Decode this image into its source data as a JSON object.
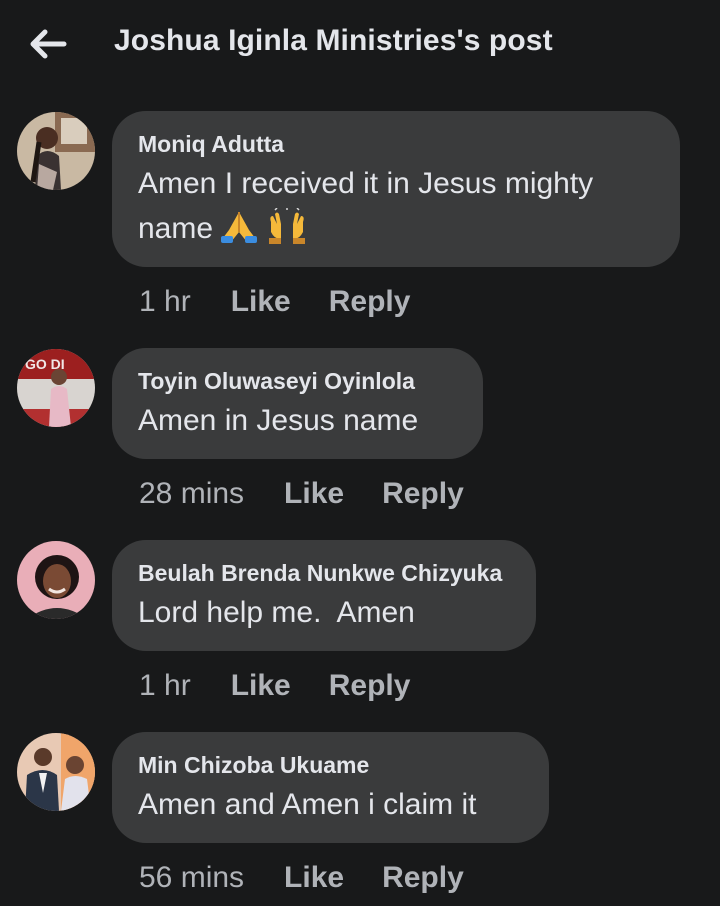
{
  "header": {
    "title": "Joshua Iginla Ministries's post"
  },
  "comments": [
    {
      "author": "Moniq Adutta",
      "text": "Amen I received it in Jesus mighty name",
      "emojis": [
        "folded-hands-emoji",
        "raising-hands-emoji"
      ],
      "time": "1 hr",
      "like_label": "Like",
      "reply_label": "Reply"
    },
    {
      "author": "Toyin Oluwaseyi Oyinlola",
      "text": "Amen in Jesus name",
      "time": "28 mins",
      "like_label": "Like",
      "reply_label": "Reply"
    },
    {
      "author": "Beulah Brenda Nunkwe Chizyuka",
      "text": "Lord help me.  Amen",
      "time": "1 hr",
      "like_label": "Like",
      "reply_label": "Reply"
    },
    {
      "author": "Min Chizoba Ukuame",
      "text": "Amen and Amen i claim it",
      "time": "56 mins",
      "like_label": "Like",
      "reply_label": "Reply"
    }
  ],
  "icons": {
    "back": "arrow-left-icon"
  },
  "colors": {
    "background": "#18191a",
    "bubble": "#3a3b3c",
    "primary_text": "#e4e6eb",
    "secondary_text": "#b0b3b8"
  }
}
